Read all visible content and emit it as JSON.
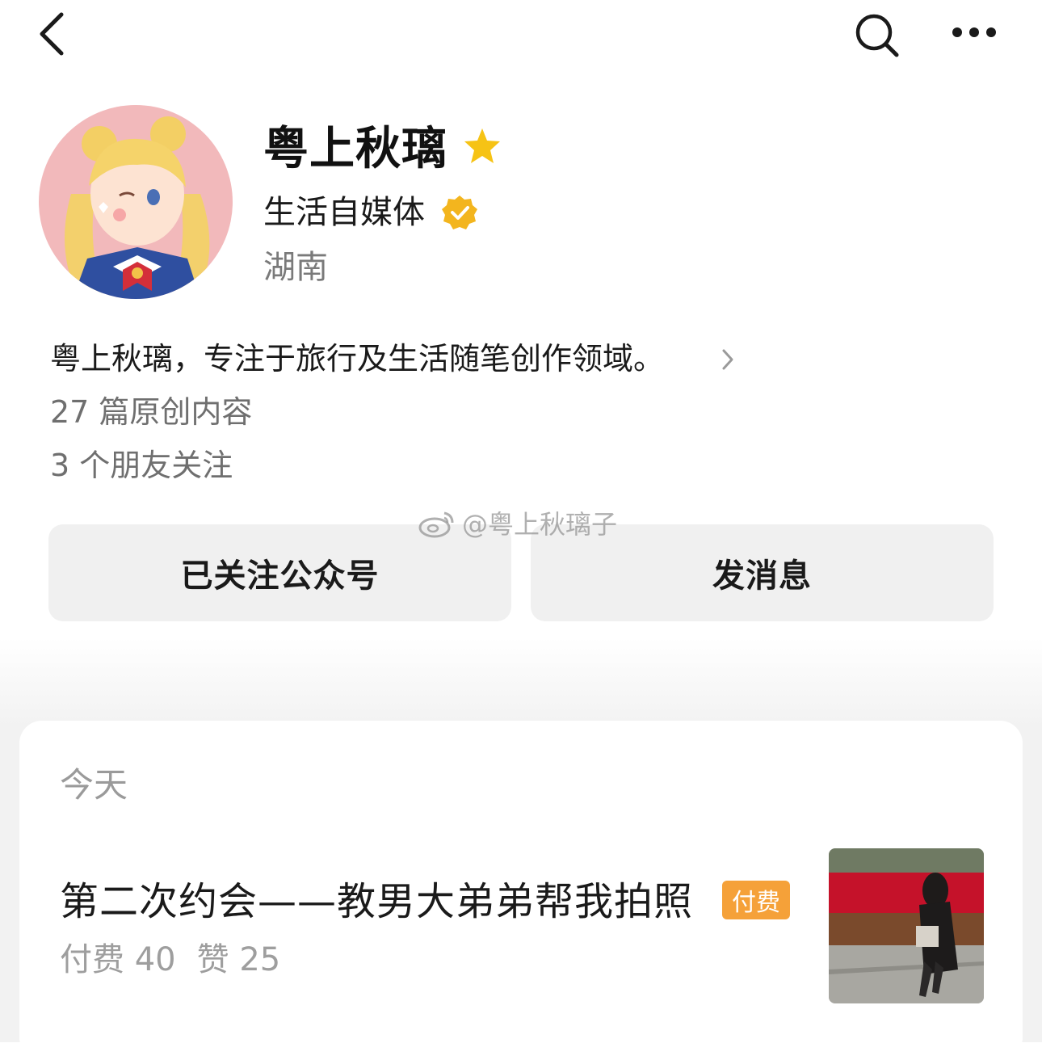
{
  "profile": {
    "name": "粤上秋璃",
    "category": "生活自媒体",
    "location": "湖南",
    "bio": "粤上秋璃，专注于旅行及生活随笔创作领域。",
    "original_count": "27 篇原创内容",
    "friends_following": "3 个朋友关注"
  },
  "actions": {
    "follow_label": "已关注公众号",
    "message_label": "发消息"
  },
  "watermark": "@粤上秋璃子",
  "feed": {
    "date": "今天",
    "article": {
      "title": "第二次约会——教男大弟弟帮我拍照",
      "badge": "付费",
      "paid": "付费 40",
      "likes": "赞 25"
    }
  },
  "icons": {
    "back": "chevron-left-icon",
    "search": "search-icon",
    "more": "more-dots-icon",
    "star": "star-icon",
    "verified": "verified-badge-icon",
    "weibo": "weibo-logo-icon"
  },
  "colors": {
    "star": "#f6c315",
    "verified": "#f3b51e",
    "paid_badge": "#f5a139",
    "button_bg": "#f0f0f0"
  }
}
